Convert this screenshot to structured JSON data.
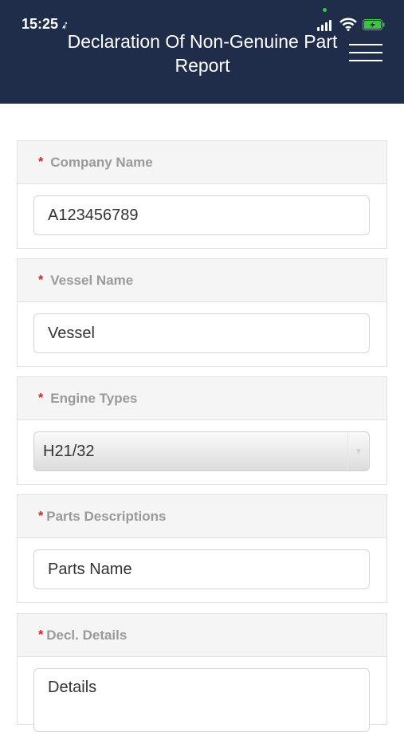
{
  "status_bar": {
    "time": "15:25",
    "location_glyph": "➶"
  },
  "header": {
    "title": "Declaration Of Non-Genuine Part Report"
  },
  "form": {
    "company": {
      "required_mark": "*",
      "label": "Company Name",
      "value": "A123456789"
    },
    "vessel": {
      "required_mark": "*",
      "label": "Vessel Name",
      "value": "Vessel"
    },
    "engine": {
      "required_mark": "*",
      "label": "Engine Types",
      "value": "H21/32",
      "arrow": "▼"
    },
    "parts": {
      "required_mark": "*",
      "label": "Parts Descriptions",
      "value": "Parts Name"
    },
    "details": {
      "required_mark": "*",
      "label": "Decl. Details",
      "value": "Details"
    }
  },
  "colors": {
    "header_bg": "#1f2d4a",
    "required": "#e02020",
    "battery": "#3ec53e"
  }
}
